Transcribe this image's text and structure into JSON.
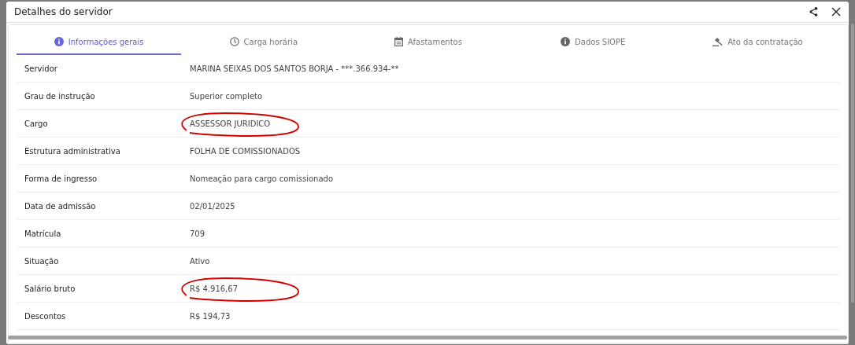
{
  "dialog": {
    "title": "Detalhes do servidor"
  },
  "tabs": [
    {
      "label": "Informações gerais",
      "kind": "info",
      "selected": true
    },
    {
      "label": "Carga horária",
      "kind": "clock",
      "selected": false
    },
    {
      "label": "Afastamentos",
      "kind": "calendar",
      "selected": false
    },
    {
      "label": "Dados SIOPE",
      "kind": "info",
      "selected": false
    },
    {
      "label": "Ato da contratação",
      "kind": "gavel",
      "selected": false
    }
  ],
  "details": [
    {
      "label": "Servidor",
      "value": "MARINA SEIXAS DOS SANTOS BORJA - ***.366.934-**",
      "circled": false
    },
    {
      "label": "Grau de instrução",
      "value": "Superior completo",
      "circled": false
    },
    {
      "label": "Cargo",
      "value": "ASSESSOR JURIDICO",
      "circled": true
    },
    {
      "label": "Estrutura administrativa",
      "value": "FOLHA DE COMISSIONADOS",
      "circled": false
    },
    {
      "label": "Forma de ingresso",
      "value": "Nomeação para cargo comissionado",
      "circled": false
    },
    {
      "label": "Data de admissão",
      "value": "02/01/2025",
      "circled": false
    },
    {
      "label": "Matrícula",
      "value": "709",
      "circled": false
    },
    {
      "label": "Situação",
      "value": "Ativo",
      "circled": false
    },
    {
      "label": "Salário bruto",
      "value": "R$ 4.916,67",
      "circled": true
    },
    {
      "label": "Descontos",
      "value": "R$ 194,73",
      "circled": false
    }
  ]
}
